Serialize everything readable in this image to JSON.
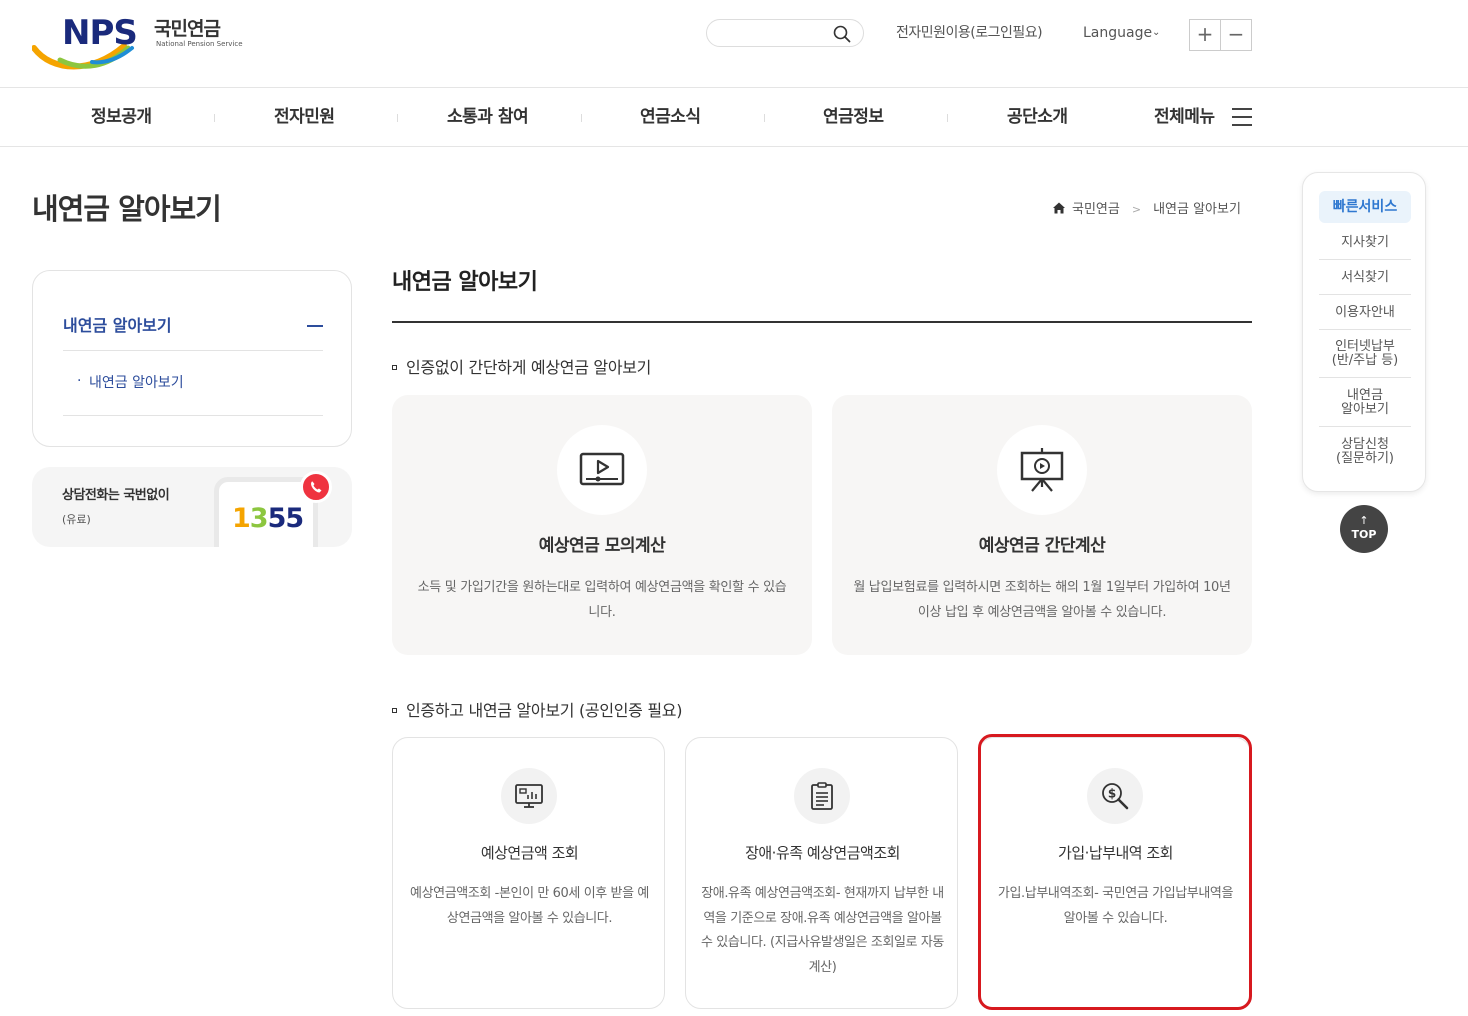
{
  "header": {
    "logo_text": "NPS",
    "logo_kor": "국민연금",
    "logo_eng": "National Pension Service",
    "search_placeholder": "",
    "civil_link": "전자민원이용(로그인필요)",
    "language_label": "Language",
    "zoom_in": "+",
    "zoom_out": "−"
  },
  "gnb": {
    "items": [
      "정보공개",
      "전자민원",
      "소통과 참여",
      "연금소식",
      "연금정보",
      "공단소개",
      "전체메뉴"
    ]
  },
  "page": {
    "title": "내연금 알아보기",
    "breadcrumb": [
      "국민연금",
      "내연금 알아보기"
    ]
  },
  "sidebar": {
    "menu_title": "내연금 알아보기",
    "sub_item": "내연금 알아보기",
    "call_title": "상담전화는 국번없이",
    "call_sub": "(유료)",
    "call_number_1": "1",
    "call_number_2": "3",
    "call_number_3": "5",
    "call_number_4": "5"
  },
  "content": {
    "title": "내연금 알아보기",
    "section1_title": "인증없이 간단하게 예상연금 알아보기",
    "big_cards": [
      {
        "title": "예상연금 모의계산",
        "desc": "소득 및 가입기간을 원하는대로 입력하여 예상연금액을 확인할 수 있습니다.",
        "icon": "video-screen-icon"
      },
      {
        "title": "예상연금 간단계산",
        "desc": "월 납입보험료를 입력하시면 조회하는 해의 1월 1일부터 가입하여 10년 이상 납입 후 예상연금액을 알아볼 수 있습니다.",
        "icon": "presentation-board-icon"
      }
    ],
    "section2_title": "인증하고 내연금 알아보기 (공인인증 필요)",
    "small_cards": [
      {
        "title": "예상연금액 조회",
        "desc": "예상연금액조회 -본인이 만 60세 이후 받을 예상연금액을 알아볼 수 있습니다.",
        "icon": "monitor-chart-icon"
      },
      {
        "title": "장애·유족 예상연금액조회",
        "desc": "장애.유족 예상연금액조회- 현재까지 납부한 내역을 기준으로 장애.유족 예상연금액을 알아볼 수 있습니다. (지급사유발생일은 조회일로 자동계산)",
        "icon": "clipboard-list-icon"
      },
      {
        "title": "가입·납부내역 조회",
        "desc": "가입.납부내역조회- 국민연금 가입납부내역을 알아볼 수 있습니다.",
        "icon": "search-dollar-icon"
      }
    ]
  },
  "quick_menu": {
    "title": "빠른서비스",
    "items": [
      "지사찾기",
      "서식찾기",
      "이용자안내",
      "인터넷납부\n(반/주납 등)",
      "내연금\n알아보기",
      "상담신청\n(질문하기)"
    ],
    "top_label": "TOP",
    "top_arrow": "↑"
  },
  "colors": {
    "brand_navy": "#1a2a7c",
    "lnb_blue": "#2d4d9c",
    "quick_blue": "#2f78d0",
    "highlight_red": "#d7191f",
    "call_red": "#ef3340"
  }
}
